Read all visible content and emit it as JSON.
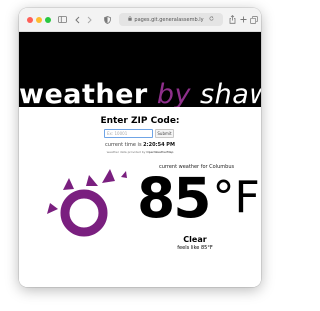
{
  "browser": {
    "url": "pages.git.generalassemb.ly",
    "colors": {
      "close": "#fe5f57",
      "minimize": "#febc2e",
      "maximize": "#28c840"
    },
    "icons": [
      "sidebar-icon",
      "back-icon",
      "forward-icon",
      "privacy-shield-icon",
      "lock-icon",
      "refresh-icon",
      "share-icon",
      "new-tab-icon",
      "tab-overview-icon"
    ]
  },
  "header": {
    "title_word": "weather",
    "title_by": "by",
    "title_name": "shawn",
    "accent_color": "#8e2f8b"
  },
  "zip": {
    "label": "Enter ZIP Code:",
    "placeholder": "Ex: 10001",
    "submit_label": "Submit"
  },
  "time": {
    "prefix": "current time is",
    "value": "2:20:54 PM"
  },
  "credit": {
    "prefix": "weather data provided by",
    "source": "OpenWeatherMap"
  },
  "weather": {
    "location_text": "current weather for Columbus",
    "temperature": "85",
    "unit": "°F",
    "condition": "Clear",
    "feels_like": "feels like 85°F",
    "icon": "sun-icon",
    "icon_color": "#7a1f7f"
  }
}
